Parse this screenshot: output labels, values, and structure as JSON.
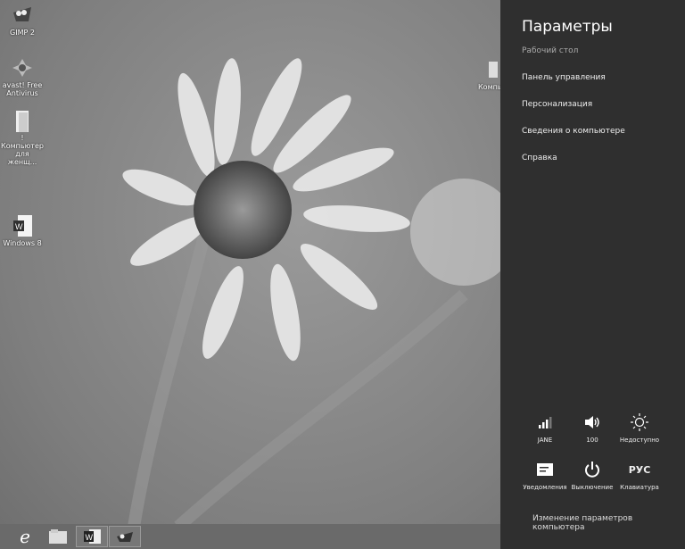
{
  "desktop": {
    "icons": [
      {
        "label": "GIMP 2",
        "icon": "gimp-icon"
      },
      {
        "label": "avast! Free Antivirus",
        "icon": "avast-icon"
      },
      {
        "label": "!Компьютер для женщ...",
        "icon": "folder-icon"
      },
      {
        "label": "Windows 8",
        "icon": "word-document-icon"
      },
      {
        "label": "Компь",
        "icon": "computer-icon"
      }
    ]
  },
  "taskbar": {
    "items": [
      {
        "name": "internet-explorer",
        "icon": "ie-icon"
      },
      {
        "name": "file-explorer",
        "icon": "folder-icon"
      },
      {
        "name": "word",
        "icon": "word-icon"
      },
      {
        "name": "gimp",
        "icon": "gimp-icon"
      }
    ]
  },
  "settings": {
    "title": "Параметры",
    "subtitle": "Рабочий стол",
    "menu": [
      "Панель управления",
      "Персонализация",
      "Сведения о компьютере",
      "Справка"
    ],
    "quick": [
      {
        "label": "JANE",
        "icon": "wifi-signal-icon"
      },
      {
        "label": "100",
        "icon": "volume-icon"
      },
      {
        "label": "Недоступно",
        "icon": "brightness-icon"
      },
      {
        "label": "Уведомления",
        "icon": "notifications-icon"
      },
      {
        "label": "Выключение",
        "icon": "power-icon"
      },
      {
        "label": "Клавиатура",
        "icon": "keyboard-icon",
        "text": "РУС"
      }
    ],
    "change_pc_settings": "Изменение параметров компьютера"
  }
}
